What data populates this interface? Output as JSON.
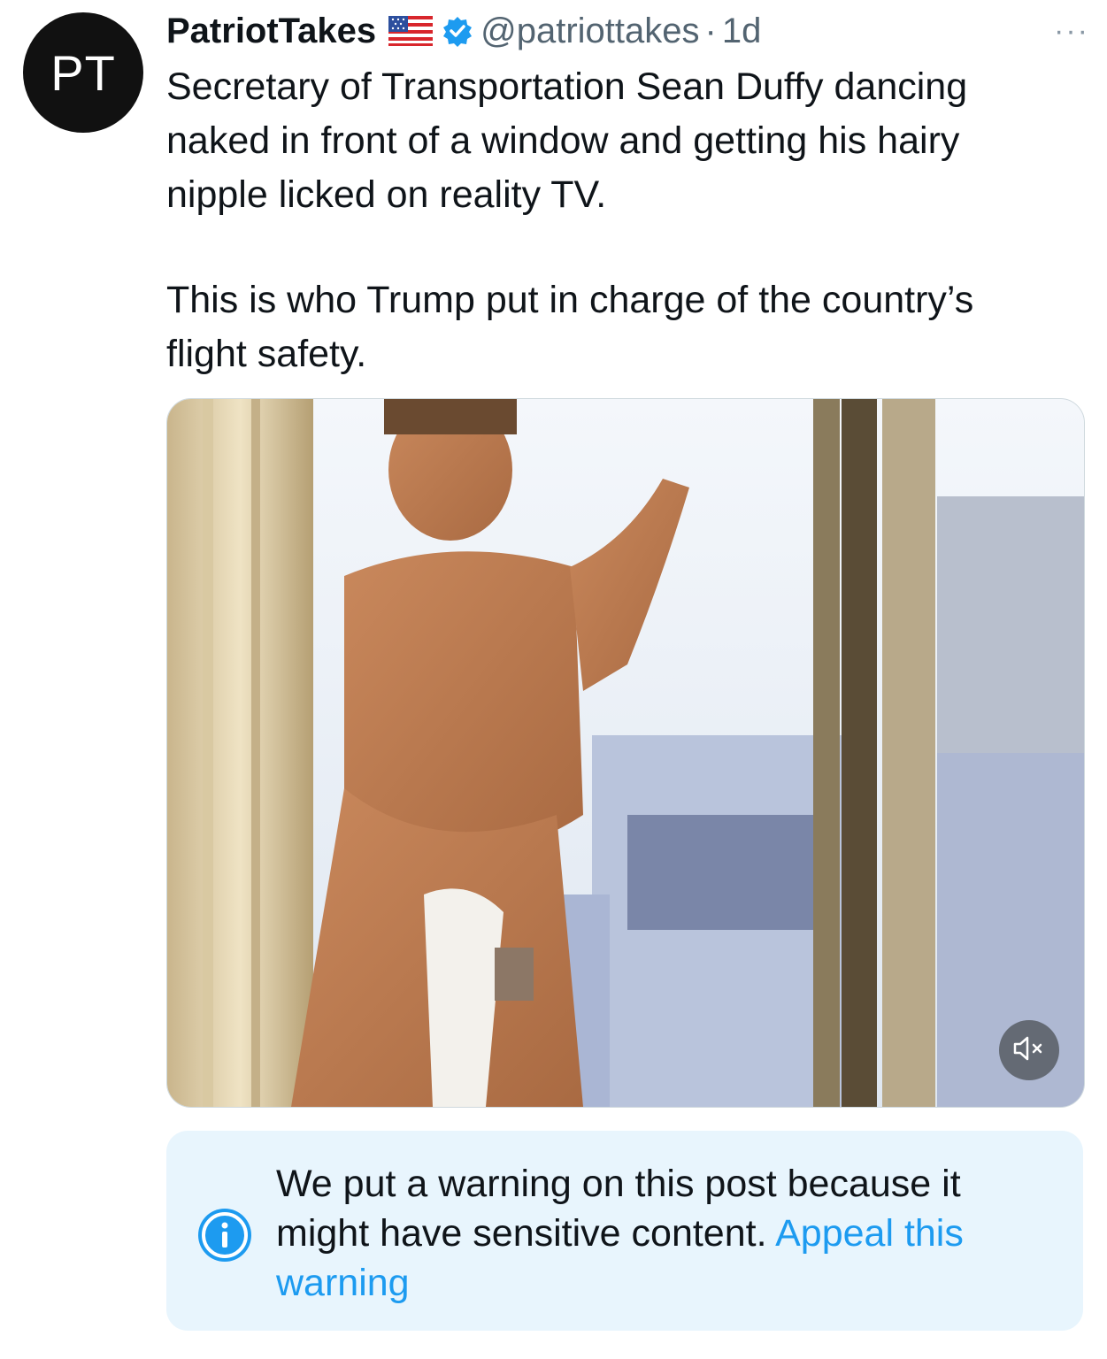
{
  "author": {
    "avatar_text": "PT",
    "name": "PatriotTakes",
    "handle": "@patriottakes",
    "separator": "·",
    "time": "1d",
    "flag_icon": "us-flag-icon",
    "verified_icon": "verified-badge-icon"
  },
  "more_label": "···",
  "tweet": {
    "paragraph1": "Secretary of Transportation Sean Duffy dancing naked in front of a window and getting his hairy nipple licked on reality TV.",
    "paragraph2": "This is who Trump put in charge of the country’s flight safety."
  },
  "media": {
    "mute_icon": "speaker-muted-icon"
  },
  "warning": {
    "icon": "info-icon",
    "text": "We put a warning on this post because it might have sensitive content.",
    "link": "Appeal this warning"
  },
  "colors": {
    "accent": "#1d9bf0",
    "secondary_text": "#536471",
    "warning_bg": "#e8f5fd"
  }
}
